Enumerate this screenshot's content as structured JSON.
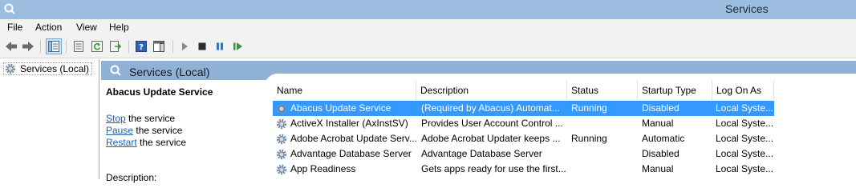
{
  "window": {
    "title": "Services",
    "app_icon": "gear-magnifier-icon"
  },
  "menu": [
    "File",
    "Action",
    "View",
    "Help"
  ],
  "toolbar": {
    "buttons": [
      {
        "name": "back-button",
        "icon": "arrow-left-icon"
      },
      {
        "name": "forward-button",
        "icon": "arrow-right-icon"
      },
      {
        "name": "show-hide-console-tree-button",
        "icon": "console-tree-icon"
      },
      {
        "name": "properties-button",
        "icon": "properties-icon"
      },
      {
        "name": "refresh-button",
        "icon": "refresh-icon"
      },
      {
        "name": "export-list-button",
        "icon": "export-icon"
      },
      {
        "name": "help-button",
        "icon": "help-icon"
      },
      {
        "name": "show-action-pane-button",
        "icon": "action-pane-icon"
      },
      {
        "name": "start-service-button",
        "icon": "play-icon"
      },
      {
        "name": "stop-service-button",
        "icon": "stop-icon"
      },
      {
        "name": "pause-service-button",
        "icon": "pause-icon"
      },
      {
        "name": "resume-service-button",
        "icon": "resume-icon"
      }
    ]
  },
  "tree": {
    "root_label": "Services (Local)"
  },
  "panel": {
    "title": "Services (Local)"
  },
  "detail": {
    "service_name": "Abacus Update Service",
    "actions": [
      {
        "link": "Stop",
        "rest": " the service"
      },
      {
        "link": "Pause",
        "rest": " the service"
      },
      {
        "link": "Restart",
        "rest": " the service"
      }
    ],
    "description_label": "Description:"
  },
  "list": {
    "columns": [
      "Name",
      "Description",
      "Status",
      "Startup Type",
      "Log On As"
    ],
    "sorted_column": "Name",
    "selected_index": 0,
    "rows": [
      {
        "name": "Abacus Update Service",
        "description": "(Required by Abacus) Automat...",
        "status": "Running",
        "startup": "Disabled",
        "logon": "Local Syste..."
      },
      {
        "name": "ActiveX Installer (AxInstSV)",
        "description": "Provides User Account Control ...",
        "status": "",
        "startup": "Manual",
        "logon": "Local Syste..."
      },
      {
        "name": "Adobe Acrobat Update Serv...",
        "description": "Adobe Acrobat Updater keeps ...",
        "status": "Running",
        "startup": "Automatic",
        "logon": "Local Syste..."
      },
      {
        "name": "Advantage Database Server",
        "description": "Advantage Database Server",
        "status": "",
        "startup": "Disabled",
        "logon": "Local Syste..."
      },
      {
        "name": "App Readiness",
        "description": "Gets apps ready for use the first...",
        "status": "",
        "startup": "Manual",
        "logon": "Local Syste..."
      }
    ]
  },
  "colors": {
    "titlebar": "#9cbde0",
    "panel_header": "#8fb1d6",
    "selection": "#3399ff",
    "link": "#1f5fb0"
  }
}
